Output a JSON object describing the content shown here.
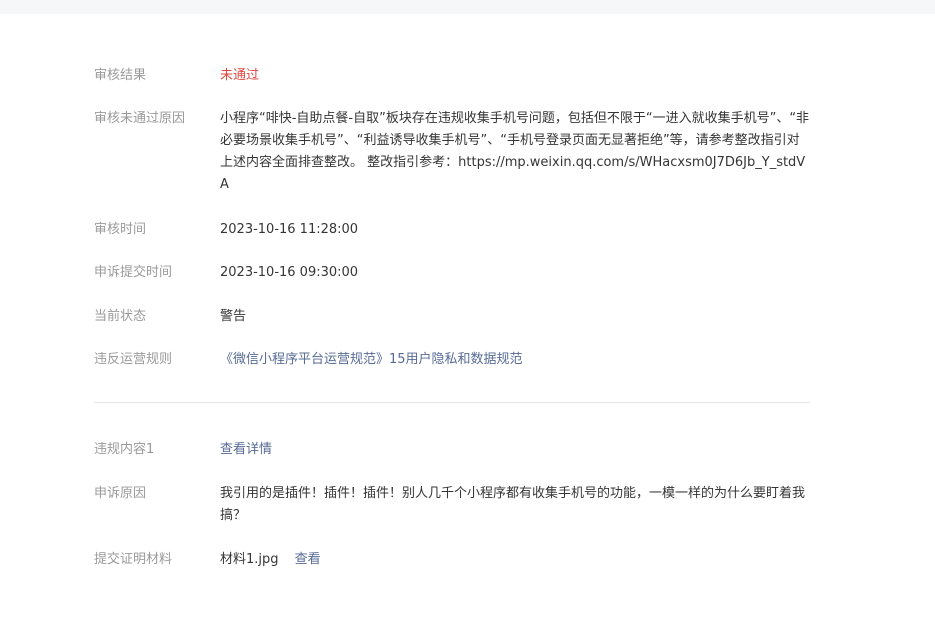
{
  "review": {
    "result_label": "审核结果",
    "result_value": "未通过",
    "reason_label": "审核未通过原因",
    "reason_value": "小程序“啡快-自助点餐-自取”板块存在违规收集手机号问题，包括但不限于“一进入就收集手机号”、“非必要场景收集手机号”、“利益诱导收集手机号”、“手机号登录页面无显著拒绝”等，请参考整改指引对上述内容全面排查整改。 整改指引参考：https://mp.weixin.qq.com/s/WHacxsm0J7D6Jb_Y_stdVA",
    "time_label": "审核时间",
    "time_value": "2023-10-16 11:28:00",
    "appeal_time_label": "申诉提交时间",
    "appeal_time_value": "2023-10-16 09:30:00",
    "status_label": "当前状态",
    "status_value": "警告",
    "rule_label": "违反运营规则",
    "rule_value": "《微信小程序平台运营规范》15用户隐私和数据规范"
  },
  "appeal": {
    "violation_label": "违规内容1",
    "violation_value": "查看详情",
    "reason_label": "申诉原因",
    "reason_value": "我引用的是插件！插件！插件！别人几千个小程序都有收集手机号的功能，一模一样的为什么要盯着我搞？",
    "material_label": "提交证明材料",
    "material_file": "材料1.jpg",
    "material_view": "查看"
  },
  "colors": {
    "label": "#9a9a9a",
    "text": "#353535",
    "fail": "#e0463f",
    "link": "#576b95",
    "divider": "#e7e7e7"
  }
}
